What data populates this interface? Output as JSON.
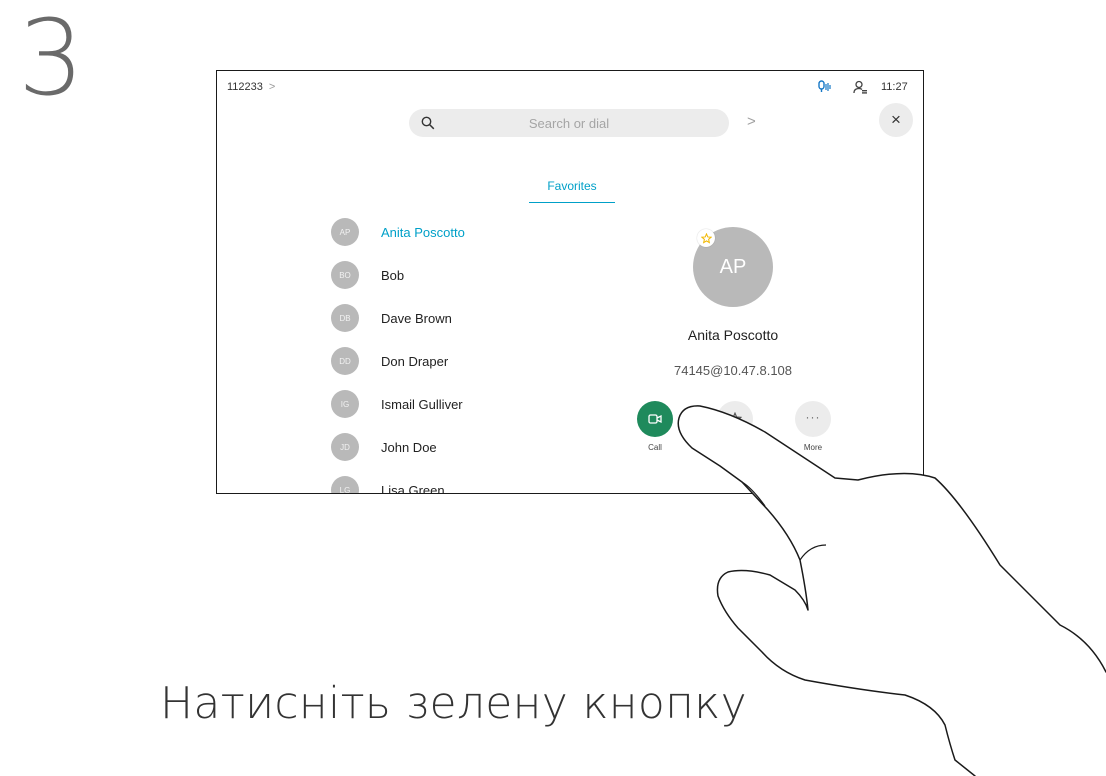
{
  "step": {
    "number": "3"
  },
  "caption": "Натисніть зелену кнопку",
  "device": {
    "topbar": {
      "title": "112233",
      "chevron": ">",
      "time": "11:27",
      "mic_icon": "mic-icon",
      "person_icon": "person-icon"
    },
    "search": {
      "placeholder": "Search or dial",
      "arrow": ">"
    },
    "close_label": "×",
    "tab": "Favorites",
    "contacts": [
      {
        "initials": "AP",
        "name": "Anita Poscotto",
        "selected": true
      },
      {
        "initials": "BO",
        "name": "Bob"
      },
      {
        "initials": "DB",
        "name": "Dave Brown"
      },
      {
        "initials": "DD",
        "name": "Don Draper"
      },
      {
        "initials": "IG",
        "name": "Ismail Gulliver"
      },
      {
        "initials": "JD",
        "name": "John Doe"
      },
      {
        "initials": "LG",
        "name": "Lisa Green"
      }
    ],
    "detail": {
      "initials": "AP",
      "name": "Anita Poscotto",
      "address": "74145@10.47.8.108",
      "favorite": true
    },
    "actions": {
      "call": "Call",
      "more": "More"
    },
    "colors": {
      "accent": "#00a0c8",
      "call_green": "#1f8a5c",
      "avatar_gray": "#b9b9b9",
      "favorite_star": "#f2b800"
    }
  }
}
